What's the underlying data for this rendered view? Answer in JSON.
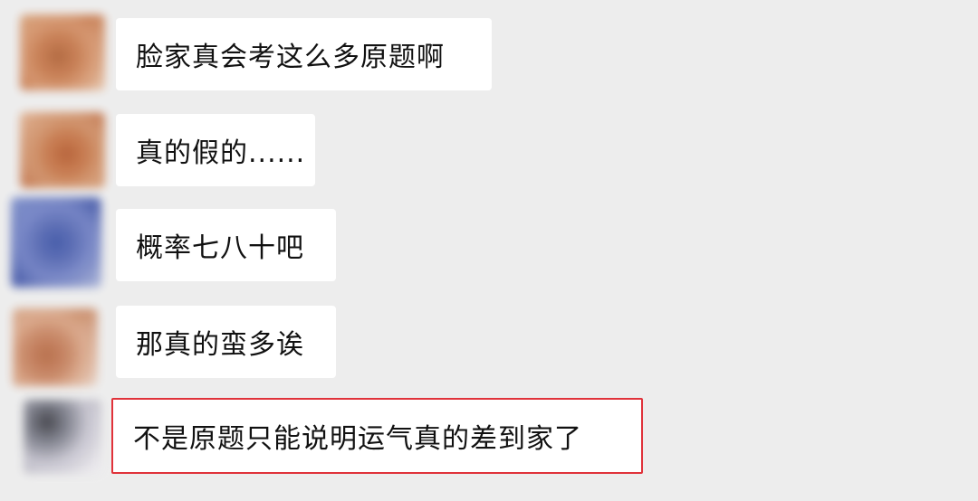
{
  "messages": [
    {
      "text": "脸家真会考这么多原题啊"
    },
    {
      "text": "真的假的......"
    },
    {
      "text": "概率七八十吧"
    },
    {
      "text": "那真的蛮多诶"
    },
    {
      "text": "不是原题只能说明运气真的差到家了"
    }
  ],
  "colors": {
    "background": "#ededed",
    "bubble": "#ffffff",
    "highlight_border": "#e0323a",
    "text": "#111111"
  }
}
